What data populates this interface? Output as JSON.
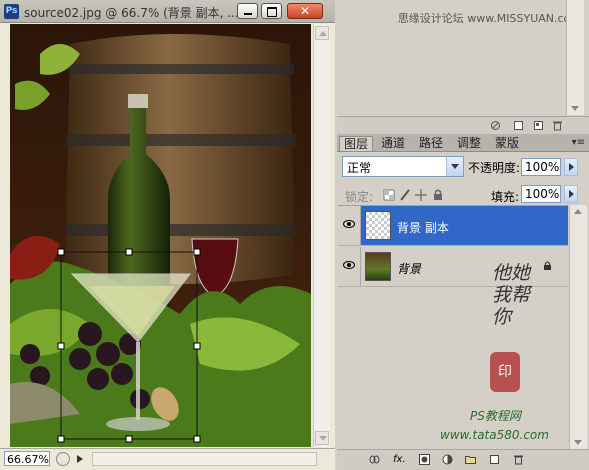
{
  "document": {
    "title": "source02.jpg @ 66.7% (背景 副本, ...",
    "app_icon": "Ps",
    "zoom": "66.67%"
  },
  "watermark": {
    "top_text": "思缘设计论坛  www.MISSYUAN.com",
    "brand_text": "他她我帮你",
    "ps_site": "PS教程网",
    "url": "www.tata580.com"
  },
  "layers_panel": {
    "tabs": [
      "图层",
      "通道",
      "路径",
      "调整",
      "蒙版"
    ],
    "active_tab": 0,
    "blend_mode": "正常",
    "opacity_label": "不透明度:",
    "opacity_value": "100%",
    "lock_label": "锁定:",
    "fill_label": "填充:",
    "fill_value": "100%",
    "layers": [
      {
        "name": "背景 副本",
        "selected": true,
        "visible": true
      },
      {
        "name": "背景",
        "selected": false,
        "visible": true,
        "locked": true
      }
    ]
  },
  "colors": {
    "selected_layer": "#3168c8",
    "panel_bg": "#d4d0c8",
    "close_button": "#c94323"
  }
}
